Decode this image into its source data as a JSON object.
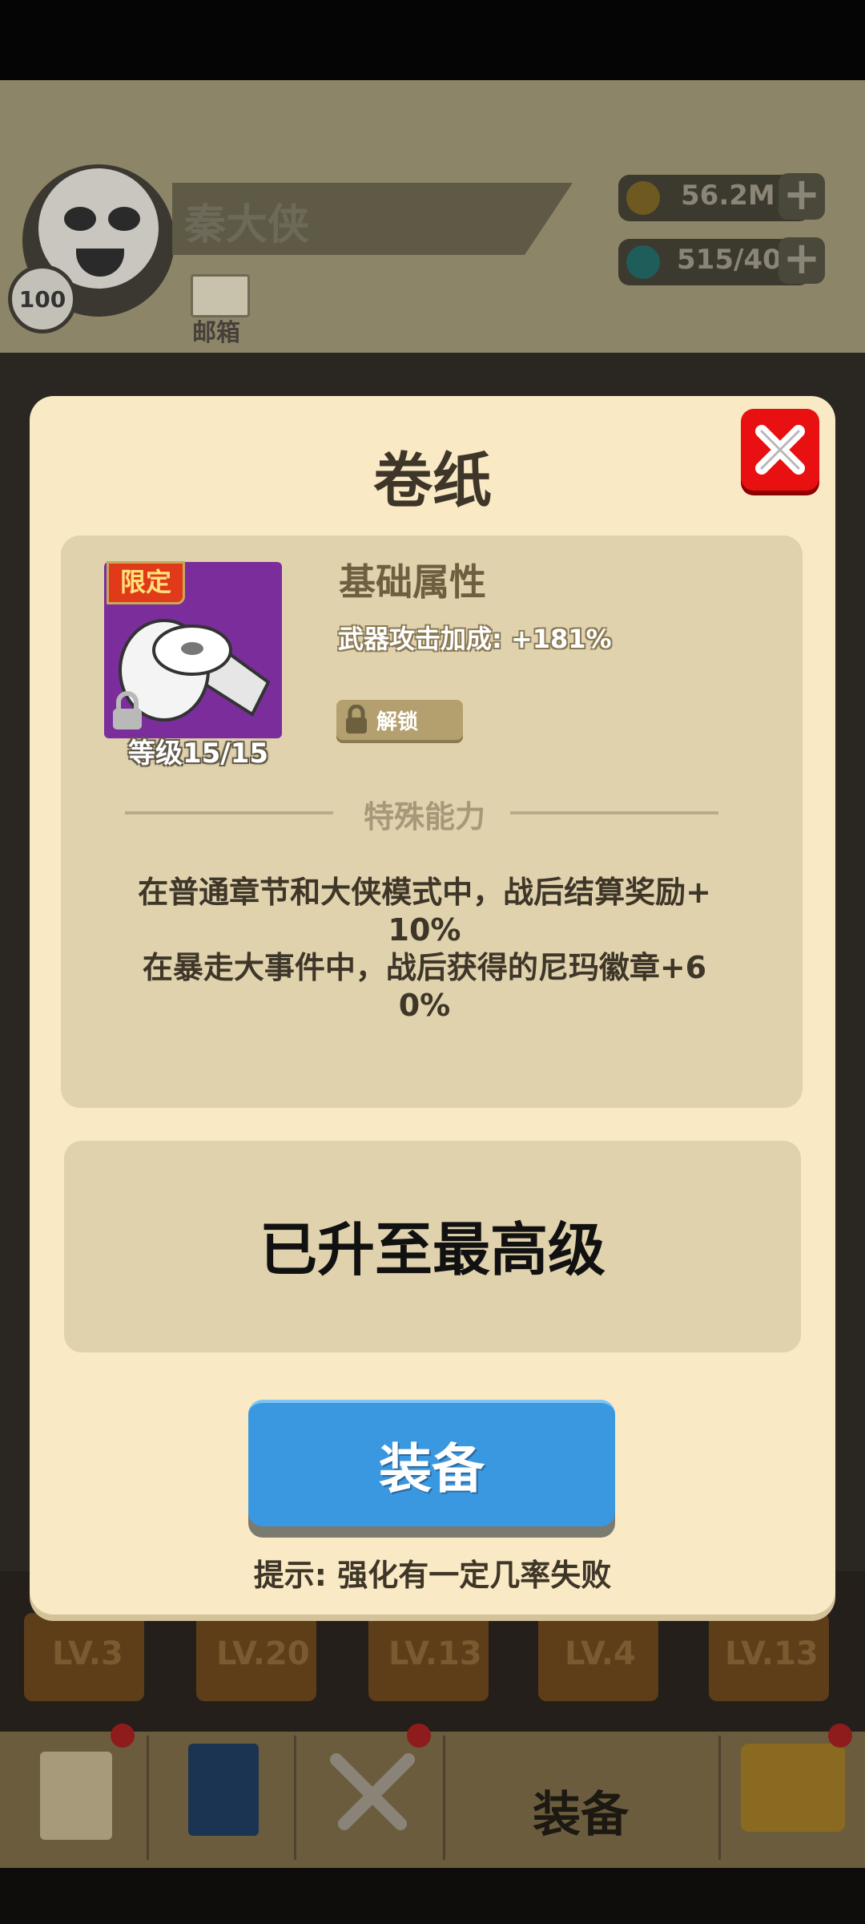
{
  "hud": {
    "player_name": "秦大侠",
    "player_level": "100",
    "mailbox_label": "邮箱",
    "gold_amount": "56.2M",
    "gems_amount": "515/40",
    "plus_symbol": "+"
  },
  "background_cards": {
    "levels": [
      "LV.3",
      "LV.20",
      "LV.13",
      "LV.4",
      "LV.13"
    ]
  },
  "bottom_nav": {
    "equip_label": "装备"
  },
  "modal": {
    "title": "卷纸",
    "limited_tag": "限定",
    "item_level": "等级15/15",
    "base_attr_title": "基础属性",
    "attr_line": "武器攻击加成: +181%",
    "unlock_label": "解锁",
    "special_title": "特殊能力",
    "special_desc": [
      "在普通章节和大侠模式中，战后结算奖励+",
      "10%",
      "在暴走大事件中，战后获得的尼玛徽章+6",
      "0%"
    ],
    "max_level_text": "已升至最高级",
    "equip_button_label": "装备",
    "hint": "提示: 强化有一定几率失败"
  },
  "colors": {
    "modal_bg": "#f9e9c4",
    "panel_bg": "#dfd2ad",
    "equip_button": "#3a98e0",
    "close_button": "#e81010",
    "item_bg": "#7b2d9b",
    "limited_tag": "#e03a1a"
  },
  "icons": {
    "close": "close-x-icon",
    "gold": "coin-icon",
    "gems": "gem-icon",
    "lock": "lock-icon",
    "item": "toilet-paper-roll-icon"
  }
}
